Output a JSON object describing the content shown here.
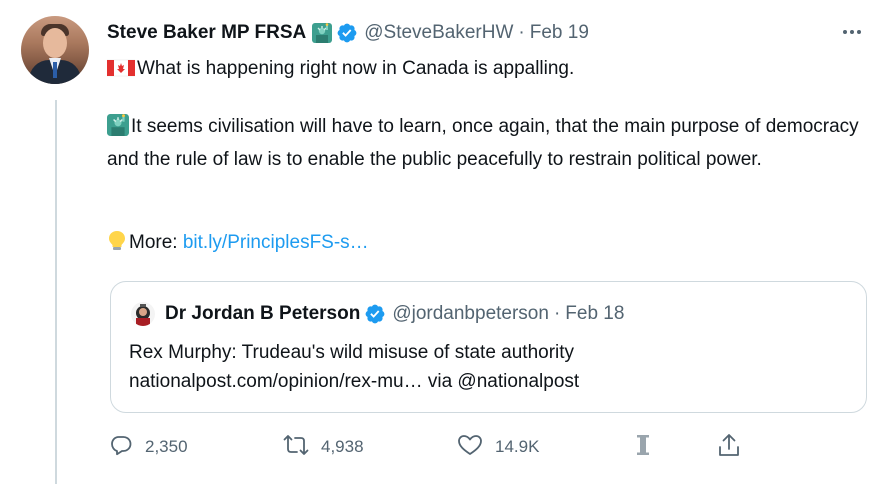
{
  "tweet": {
    "author_name": "Steve Baker MP FRSA",
    "handle": "@SteveBakerHW",
    "separator": "·",
    "date": "Feb 19",
    "line1": "What is happening right now in Canada is appalling.",
    "para2": "It seems civilisation will have to learn, once again, that the main purpose of democracy and the rule of law is to enable the public peacefully to restrain political power.",
    "more_label": "More: ",
    "more_link": "bit.ly/PrinciplesFS-s…"
  },
  "quoted_tweet": {
    "author_name": "Dr Jordan B Peterson",
    "handle": "@jordanbpeterson",
    "separator": "·",
    "date": "Feb 18",
    "line1": "Rex Murphy: Trudeau's wild misuse of state authority",
    "line2": "nationalpost.com/opinion/rex-mu… via @nationalpost"
  },
  "actions": {
    "reply_count": "2,350",
    "retweet_count": "4,938",
    "like_count": "14.9K"
  },
  "colors": {
    "text": "#0f1419",
    "secondary": "#536471",
    "link": "#1d9bf0",
    "verified": "#1d9bf0",
    "border": "#cfd9de"
  },
  "icons": [
    "more-icon",
    "verified-icon",
    "canada-flag-icon",
    "statue-of-liberty-icon",
    "lightbulb-icon",
    "reply-icon",
    "retweet-icon",
    "like-icon",
    "analytics-icon",
    "share-icon"
  ]
}
